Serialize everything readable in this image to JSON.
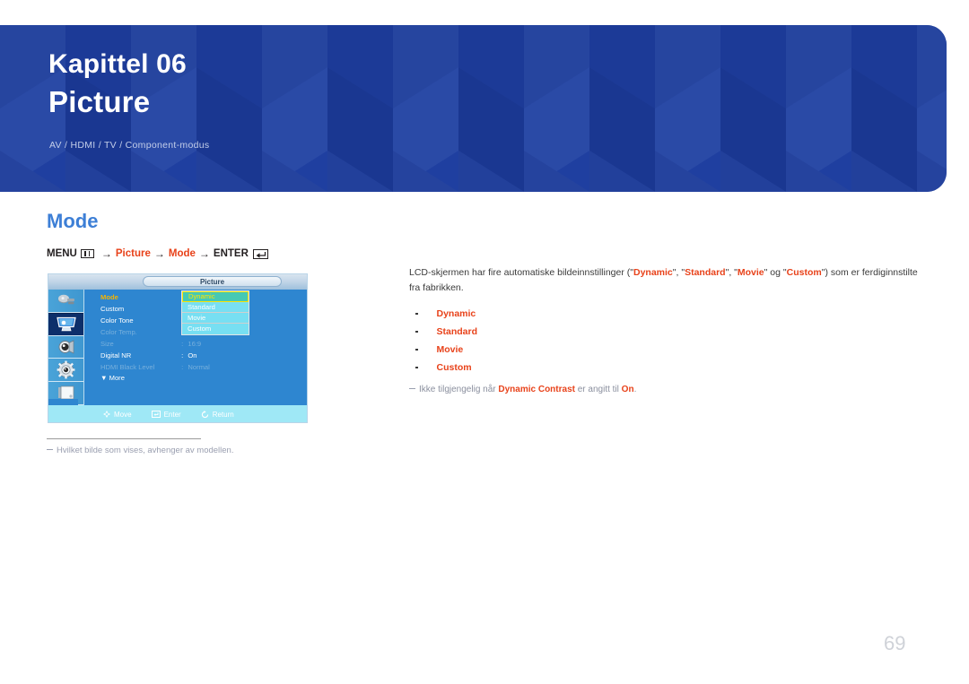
{
  "header": {
    "chapter": "Kapittel 06",
    "title": "Picture",
    "subtitle": "AV / HDMI / TV / Component-modus",
    "background_color": "#1f3fa0"
  },
  "section": {
    "title": "Mode",
    "title_color": "#3d7fd6"
  },
  "breadcrumb": {
    "menu_label": "MENU",
    "menu_icon": "menu-bars-icon",
    "arrow": "→",
    "step1": "Picture",
    "step2": "Mode",
    "enter_label": "ENTER",
    "enter_icon": "enter-return-icon",
    "accent_color": "#e8421a"
  },
  "osd": {
    "title": "Picture",
    "icons": [
      {
        "name": "input-source-icon",
        "selected": false
      },
      {
        "name": "picture-monitor-icon",
        "selected": true
      },
      {
        "name": "sound-speaker-icon",
        "selected": false
      },
      {
        "name": "setup-gear-icon",
        "selected": false
      },
      {
        "name": "multi-control-icon",
        "selected": false
      }
    ],
    "rows": [
      {
        "label": "Mode",
        "separator": ":",
        "value": "",
        "dim": false,
        "highlight": true
      },
      {
        "label": "Custom",
        "separator": "",
        "value": "",
        "dim": false,
        "highlight": false
      },
      {
        "label": "Color Tone",
        "separator": ":",
        "value": "",
        "dim": false,
        "highlight": false
      },
      {
        "label": "Color Temp.",
        "separator": "",
        "value": "",
        "dim": true,
        "highlight": false
      },
      {
        "label": "Size",
        "separator": ":",
        "value": "16:9",
        "dim": true,
        "highlight": false
      },
      {
        "label": "Digital NR",
        "separator": ":",
        "value": "On",
        "dim": false,
        "highlight": false
      },
      {
        "label": "HDMI Black Level",
        "separator": ":",
        "value": "Normal",
        "dim": true,
        "highlight": false
      }
    ],
    "more_label": "▼ More",
    "dropdown": {
      "items": [
        "Dynamic",
        "Standard",
        "Movie",
        "Custom"
      ],
      "selected": "Dynamic",
      "selected_bg": "#46c9b4",
      "selected_text": "#ffe400",
      "item_bg": "#77dff2"
    },
    "footer": [
      {
        "icon": "move-dpad-icon",
        "label": "Move"
      },
      {
        "icon": "enter-key-icon",
        "label": "Enter"
      },
      {
        "icon": "return-arrow-icon",
        "label": "Return"
      }
    ]
  },
  "left_note": {
    "text": "Hvilket bilde som vises, avhenger av modellen."
  },
  "right": {
    "intro_prefix": "LCD-skjermen har fire automatiske bildeinnstillinger (\"",
    "intro_mode1": "Dynamic",
    "intro_sep1": "\", \"",
    "intro_mode2": "Standard",
    "intro_sep2": "\", \"",
    "intro_mode3": "Movie",
    "intro_sep3": "\" og \"",
    "intro_mode4": "Custom",
    "intro_suffix": "\") som er ferdiginnstilte fra fabrikken.",
    "modes": [
      "Dynamic",
      "Standard",
      "Movie",
      "Custom"
    ],
    "avail_prefix": "Ikke tilgjengelig når ",
    "avail_bold1": "Dynamic Contrast",
    "avail_middle": " er angitt til ",
    "avail_bold2": "On",
    "avail_suffix": "."
  },
  "page": {
    "number": "69"
  }
}
